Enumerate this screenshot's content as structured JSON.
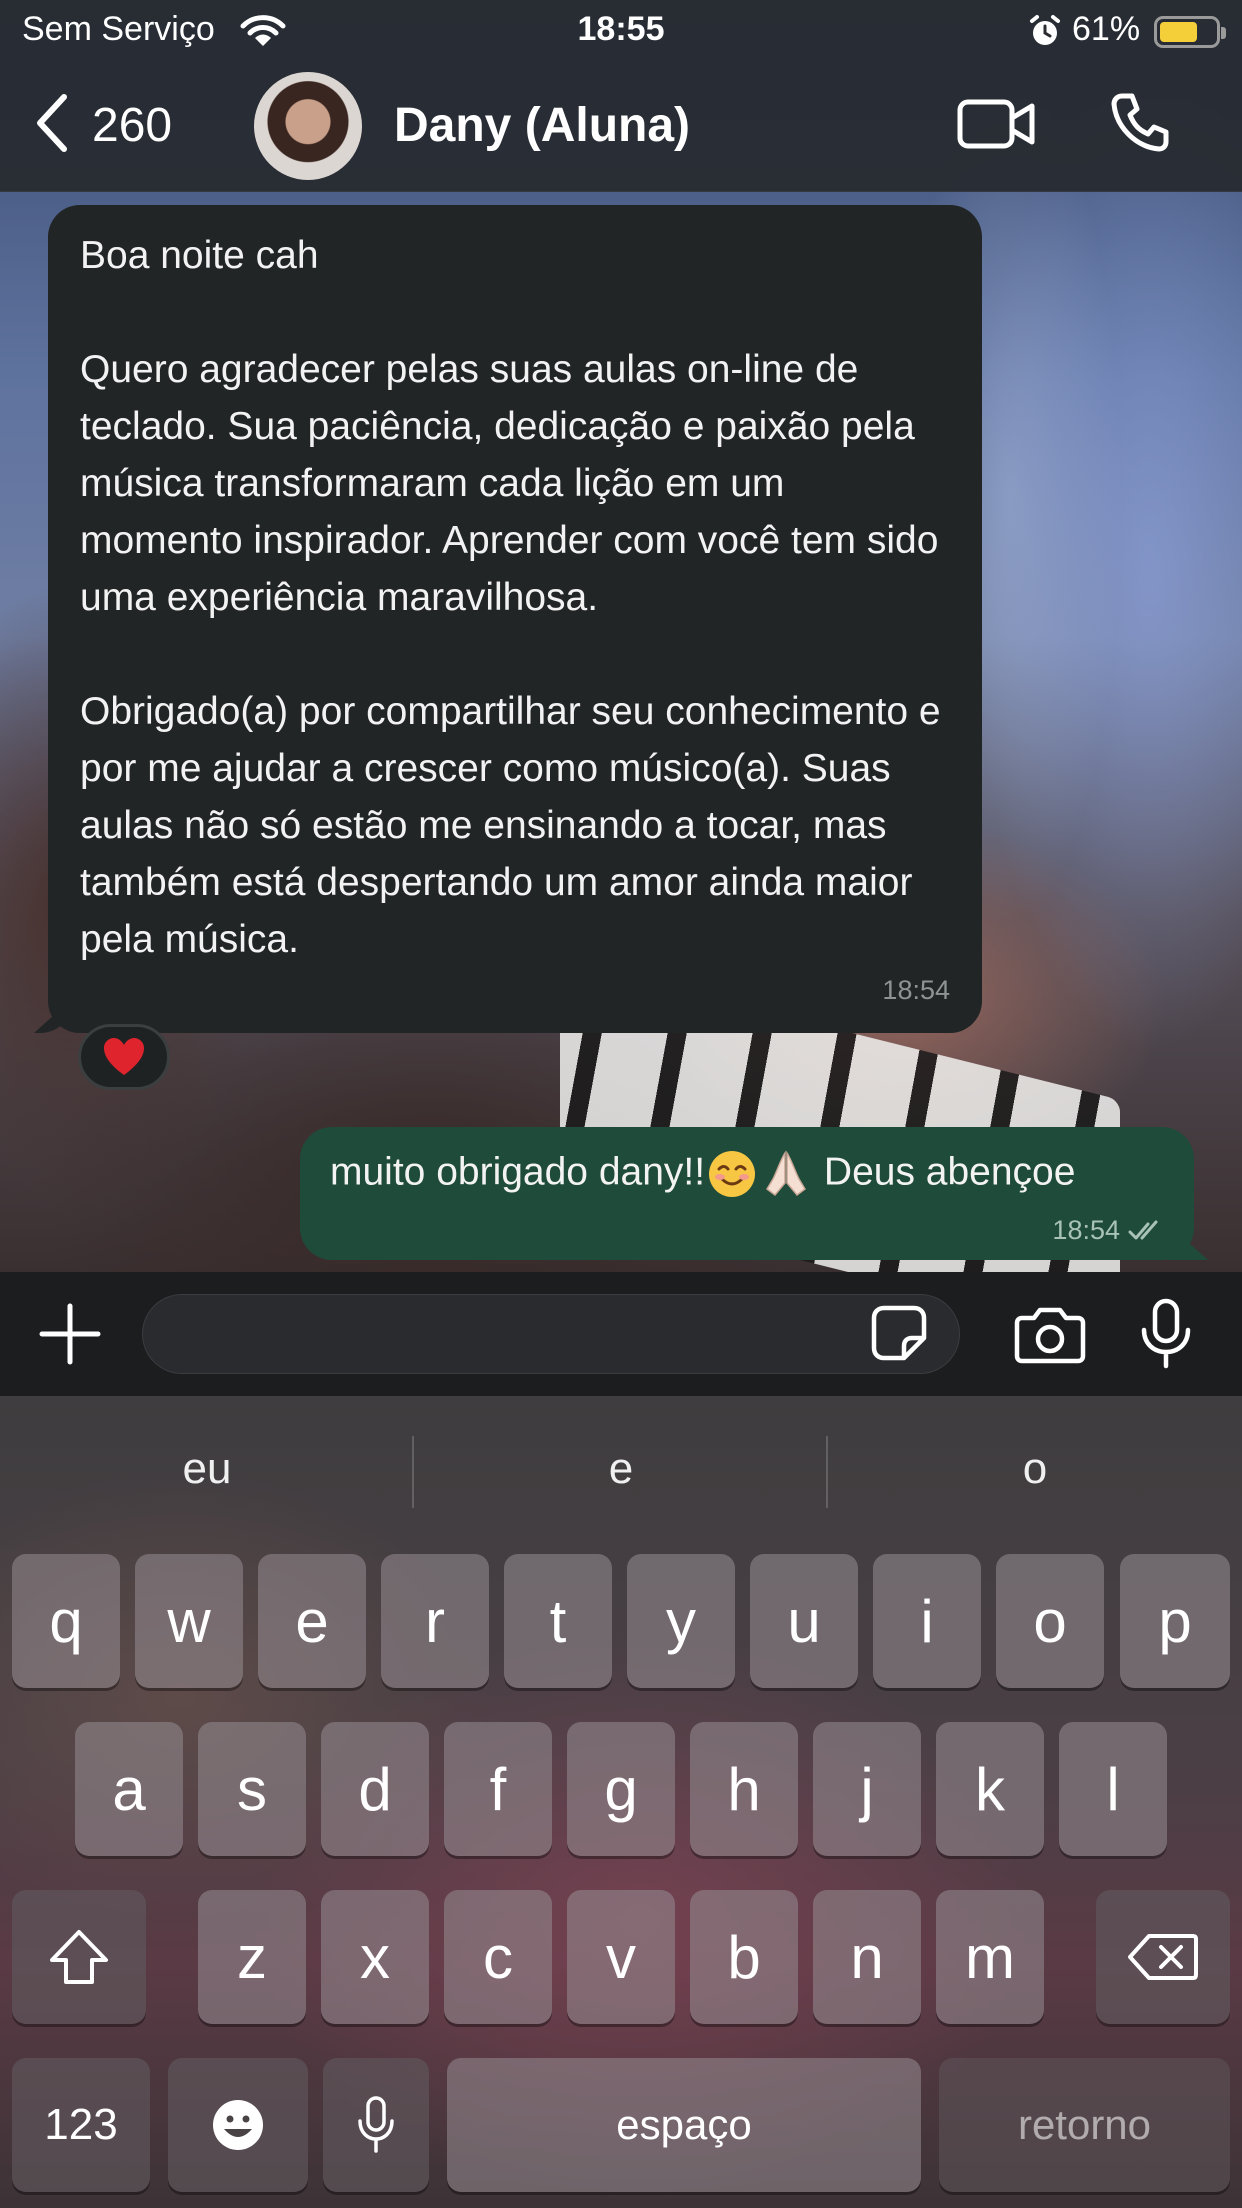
{
  "status_bar": {
    "carrier": "Sem Serviço",
    "time": "18:55",
    "battery_percent": "61%",
    "battery_level": 0.61
  },
  "header": {
    "back_count": "260",
    "contact_name": "Dany (Aluna)"
  },
  "messages": {
    "incoming": {
      "paragraphs": [
        "Boa noite cah",
        "Quero agradecer pelas suas  aulas on-line de teclado. Sua paciência, dedicação e paixão pela música transformaram cada lição em um momento inspirador. Aprender com você tem sido uma experiência maravilhosa.",
        "Obrigado(a) por compartilhar seu conhecimento e por me ajudar a crescer como músico(a). Suas aulas não só estão me ensinando a tocar, mas também está despertando  um amor ainda maior pela música."
      ],
      "time": "18:54",
      "reaction": "❤️"
    },
    "outgoing": {
      "text_before": "muito obrigado dany!!",
      "emoji_1": "☺️",
      "emoji_2": "🙏🏻",
      "text_after": "Deus abençoe",
      "time": "18:54"
    }
  },
  "keyboard": {
    "suggestions": [
      "eu",
      "e",
      "o"
    ],
    "row1": [
      "q",
      "w",
      "e",
      "r",
      "t",
      "y",
      "u",
      "i",
      "o",
      "p"
    ],
    "row2": [
      "a",
      "s",
      "d",
      "f",
      "g",
      "h",
      "j",
      "k",
      "l"
    ],
    "row3": [
      "z",
      "x",
      "c",
      "v",
      "b",
      "n",
      "m"
    ],
    "numbers_label": "123",
    "space_label": "espaço",
    "return_label": "retorno"
  },
  "icons": {
    "back": "chevron-left-icon",
    "video": "video-camera-icon",
    "call": "phone-icon",
    "plus": "plus-icon",
    "sticker": "sticker-icon",
    "camera": "camera-icon",
    "mic": "microphone-icon",
    "shift": "shift-icon",
    "delete": "backspace-icon",
    "emoji": "emoji-icon",
    "dictation": "dictation-icon"
  },
  "colors": {
    "incoming_bubble": "#222526",
    "outgoing_bubble": "#1f4b3a",
    "battery": "#f5cf3a"
  }
}
